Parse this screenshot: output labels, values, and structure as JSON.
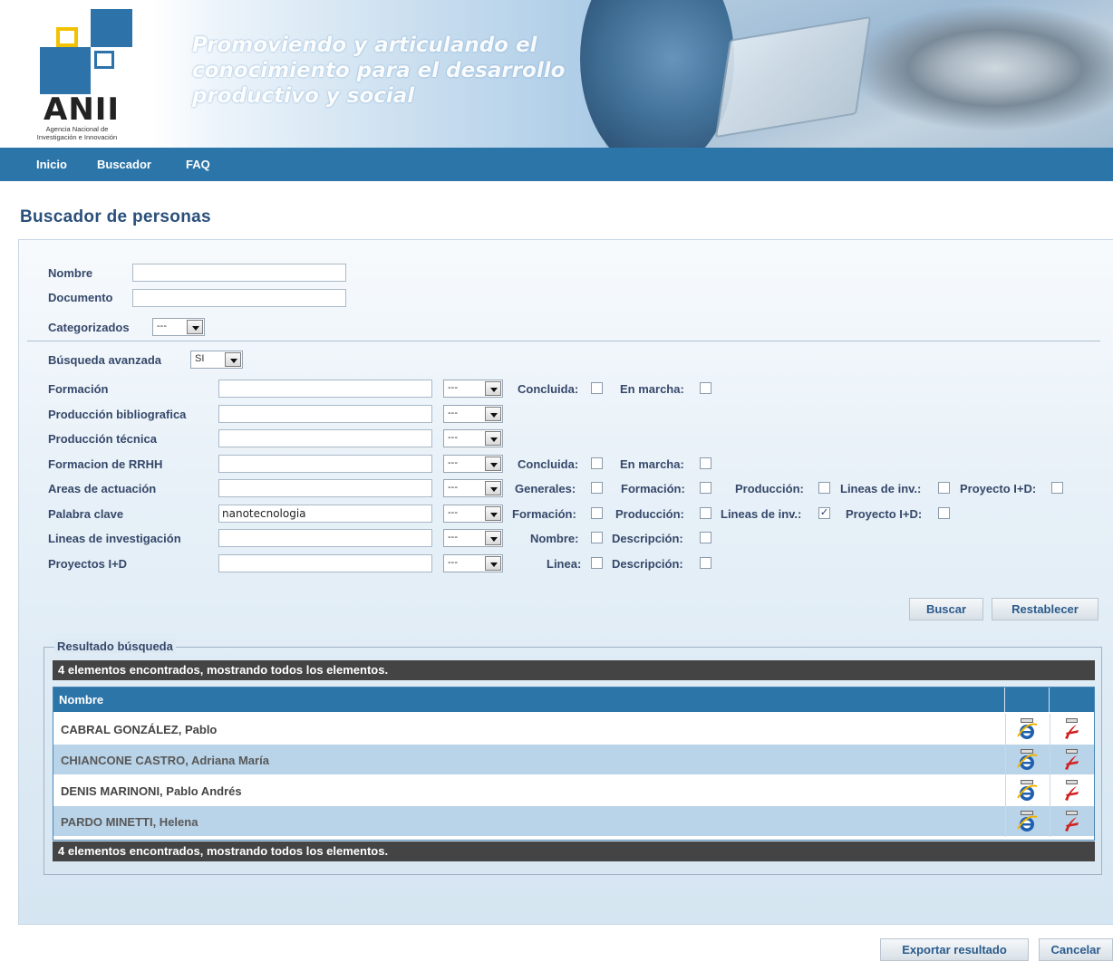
{
  "header": {
    "logo_text": "ANII",
    "logo_subtitle_1": "Agencia Nacional de",
    "logo_subtitle_2": "Investigación e Innovación",
    "slogan_1": "Promoviendo y articulando el",
    "slogan_2": "conocimiento para el desarrollo",
    "slogan_3": "productivo y social"
  },
  "nav": {
    "items": [
      "Inicio",
      "Buscador",
      "FAQ"
    ]
  },
  "page_title": "Buscador de personas",
  "form": {
    "nombre_label": "Nombre",
    "nombre_value": "",
    "documento_label": "Documento",
    "documento_value": "",
    "categorizados_label": "Categorizados",
    "categorizados_value": "---",
    "busqueda_avanzada_label": "Búsqueda avanzada",
    "busqueda_avanzada_value": "SI",
    "rows": [
      {
        "label": "Formación",
        "value": "",
        "select": "---",
        "checks": [
          {
            "label": "Concluida:",
            "checked": false
          },
          {
            "label": "En marcha:",
            "checked": false
          }
        ]
      },
      {
        "label": "Producción bibliografica",
        "value": "",
        "select": "---",
        "checks": []
      },
      {
        "label": "Producción técnica",
        "value": "",
        "select": "---",
        "checks": []
      },
      {
        "label": "Formacion de RRHH",
        "value": "",
        "select": "---",
        "checks": [
          {
            "label": "Concluida:",
            "checked": false
          },
          {
            "label": "En marcha:",
            "checked": false
          }
        ]
      },
      {
        "label": "Areas de actuación",
        "value": "",
        "select": "---",
        "checks": [
          {
            "label": "Generales:",
            "checked": false
          },
          {
            "label": "Formación:",
            "checked": false
          },
          {
            "label": "Producción:",
            "checked": false
          },
          {
            "label": "Lineas de inv.:",
            "checked": false
          },
          {
            "label": "Proyecto I+D:",
            "checked": false
          }
        ]
      },
      {
        "label": "Palabra clave",
        "value": "nanotecnologia",
        "select": "---",
        "checks": [
          {
            "label": "Formación:",
            "checked": false
          },
          {
            "label": "Producción:",
            "checked": false
          },
          {
            "label": "Lineas de inv.:",
            "checked": true
          },
          {
            "label": "Proyecto I+D:",
            "checked": false
          }
        ]
      },
      {
        "label": "Lineas de investigación",
        "value": "",
        "select": "---",
        "checks": [
          {
            "label": "Nombre:",
            "checked": false
          },
          {
            "label": "Descripción:",
            "checked": false
          }
        ]
      },
      {
        "label": "Proyectos I+D",
        "value": "",
        "select": "---",
        "checks": [
          {
            "label": "Linea:",
            "checked": false
          },
          {
            "label": "Descripción:",
            "checked": false
          }
        ]
      }
    ],
    "buscar_label": "Buscar",
    "restablecer_label": "Restablecer"
  },
  "results": {
    "legend": "Resultado búsqueda",
    "summary_top": "4 elementos encontrados, mostrando todos los elementos.",
    "summary_bottom": "4 elementos encontrados, mostrando todos los elementos.",
    "column_header": "Nombre",
    "rows": [
      "CABRAL GONZÁLEZ, Pablo",
      "CHIANCONE CASTRO, Adriana María",
      "DENIS MARINONI, Pablo Andrés",
      "PARDO MINETTI, Helena"
    ]
  },
  "footer": {
    "export_label": "Exportar resultado",
    "cancel_label": "Cancelar"
  },
  "icons": {
    "html_export": "ie-html-icon",
    "pdf_export": "pdf-icon"
  },
  "colors": {
    "nav": "#2c75a9",
    "result_bar": "#444444",
    "title": "#2a4f7a",
    "row_alt": "#b9d3e8"
  }
}
